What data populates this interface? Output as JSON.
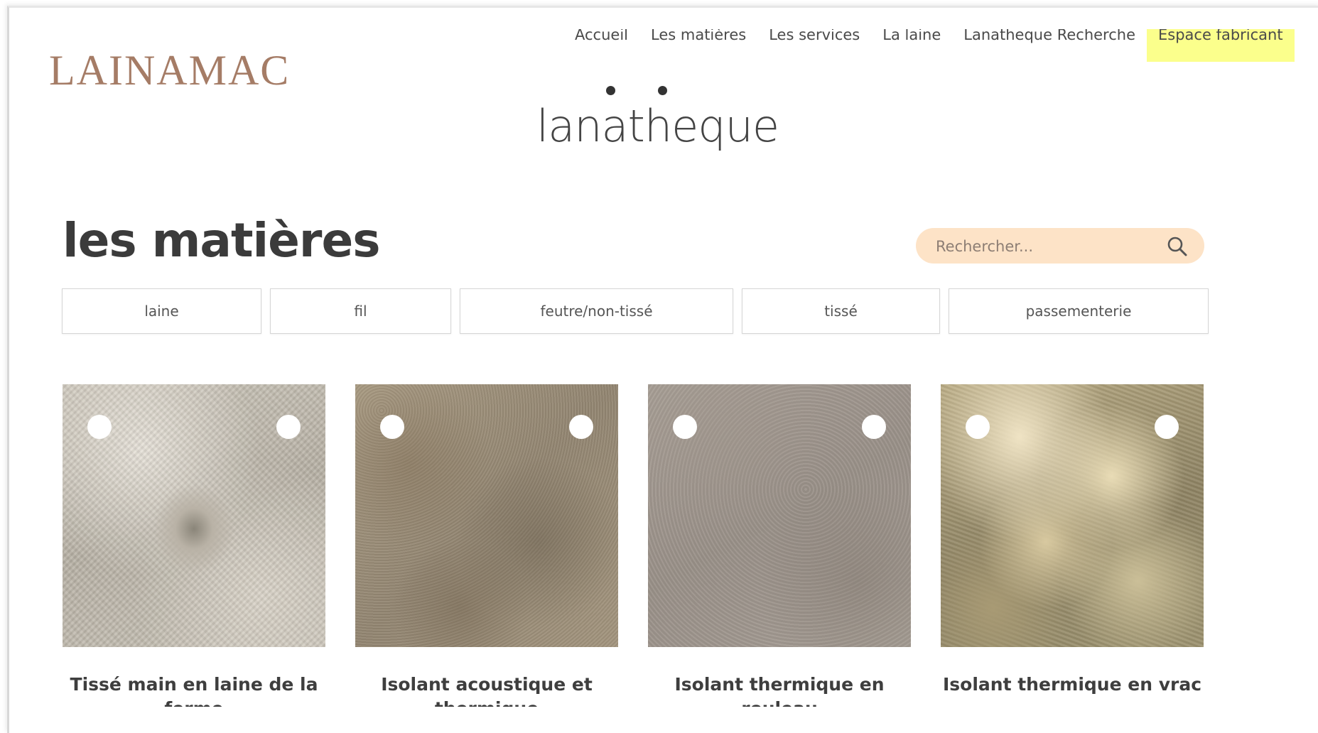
{
  "brand": {
    "logo_text": "LAINAMAC"
  },
  "nav": {
    "items": [
      {
        "label": "Accueil"
      },
      {
        "label": "Les matières"
      },
      {
        "label": "Les services"
      },
      {
        "label": "La laine"
      },
      {
        "label": "Lanatheque Recherche"
      },
      {
        "label": "Espace fabricant"
      }
    ],
    "highlight_color": "#fbff8c"
  },
  "sublogo": {
    "text": "lanatheque"
  },
  "page": {
    "title": "les matières"
  },
  "search": {
    "placeholder": "Rechercher..."
  },
  "filters": [
    {
      "label": "laine"
    },
    {
      "label": "fil"
    },
    {
      "label": "feutre/non-tissé"
    },
    {
      "label": "tissé"
    },
    {
      "label": "passementerie"
    }
  ],
  "products": [
    {
      "title": "Tissé main en laine de la ferme",
      "image": "woven-wool-fabric"
    },
    {
      "title": "Isolant acoustique et thermique",
      "image": "felt-panel"
    },
    {
      "title": "Isolant thermique en rouleau",
      "image": "felt-roll"
    },
    {
      "title": "Isolant thermique en vrac",
      "image": "loose-wool"
    }
  ],
  "colors": {
    "brand": "#a57c66",
    "search_bg": "#fde3c7",
    "title_text": "#3b3b3b"
  }
}
